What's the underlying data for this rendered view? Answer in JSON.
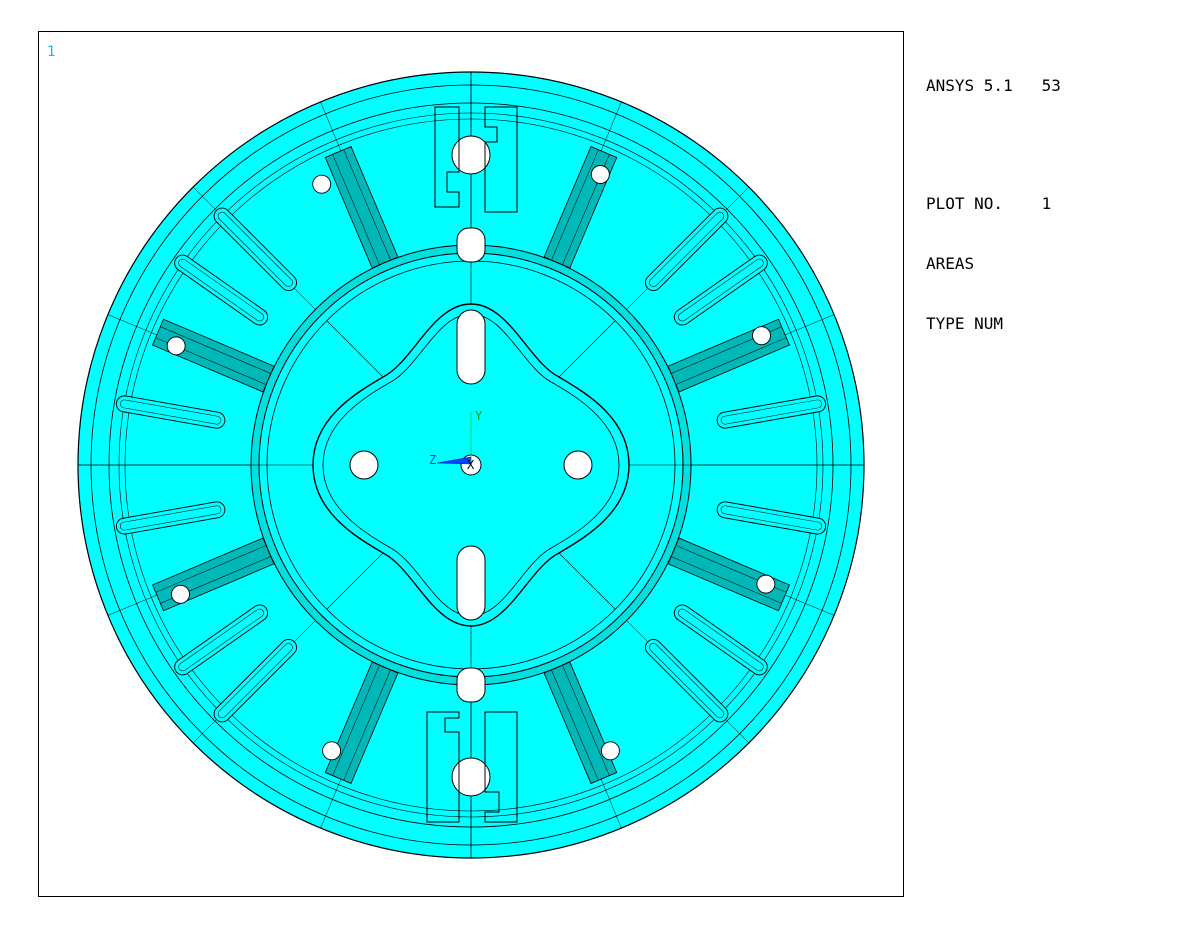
{
  "legend": {
    "program": "ANSYS 5.1",
    "revision": "53",
    "plot_no_label": "PLOT NO.",
    "plot_no": "1",
    "entity": "AREAS",
    "numbering": "TYPE NUM"
  },
  "viewport": {
    "window_number": "1",
    "triad": {
      "y_label": "Y",
      "z_label": "Z",
      "x_label": "X"
    }
  },
  "colors": {
    "area_fill": "#00ffff",
    "area_shade": "#00b8b8",
    "edge": "#000000",
    "triad_z": "#0040ff",
    "triad_y": "#00c000"
  }
}
